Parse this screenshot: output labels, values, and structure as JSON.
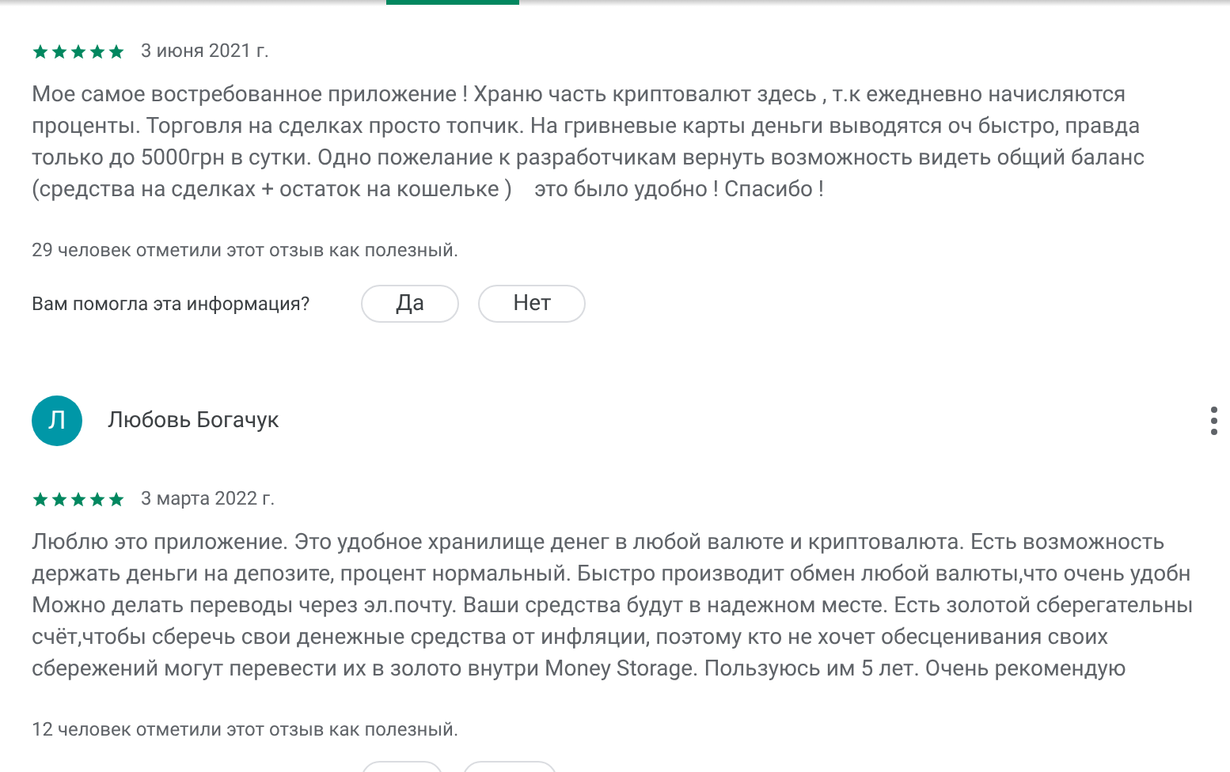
{
  "tabs_indicator": {
    "selected": true
  },
  "reviews": [
    {
      "stars": 5,
      "date": "3 июня 2021 г.",
      "lines": [
        "Мое самое востребованное приложение ! Храню часть криптовалют здесь , т.к ежедневно начисляются",
        "проценты. Торговля на сделках просто топчик. На гривневые карты деньги выводятся оч быстро, правда",
        "только до 5000грн в сутки. Одно пожелание к разработчикам вернуть возможность видеть общий баланс",
        "(средства на сделках + остаток на кошельке )    это было удобно ! Спасибо !"
      ],
      "helpful_count": "29 человек отметили этот отзыв как полезный.",
      "helpful_question": "Вам помогла эта информация?",
      "buttons": [
        "Да",
        "Нет"
      ]
    },
    {
      "author": {
        "initial": "Л",
        "name": "Любовь Богачук"
      },
      "stars": 5,
      "date": "3 марта 2022 г.",
      "lines": [
        "Люблю это приложение. Это удобное хранилище денег в любой валюте и криптовалюта. Есть возможность",
        "держать деньги на депозите, процент нормальный. Быстро производит обмен любой валюты,что очень удобн",
        "Можно делать переводы через эл.почту. Ваши средства будут в надежном месте. Есть золотой сберегательны",
        "счёт,чтобы сберечь свои денежные средства от инфляции, поэтому кто не хочет обесценивания своих",
        "сбережений могут перевести их в золото внутри Money Storage. Пользуюсь им 5 лет. Очень рекомендую"
      ],
      "helpful_count": "12 человек отметили этот отзыв как полезный."
    }
  ]
}
